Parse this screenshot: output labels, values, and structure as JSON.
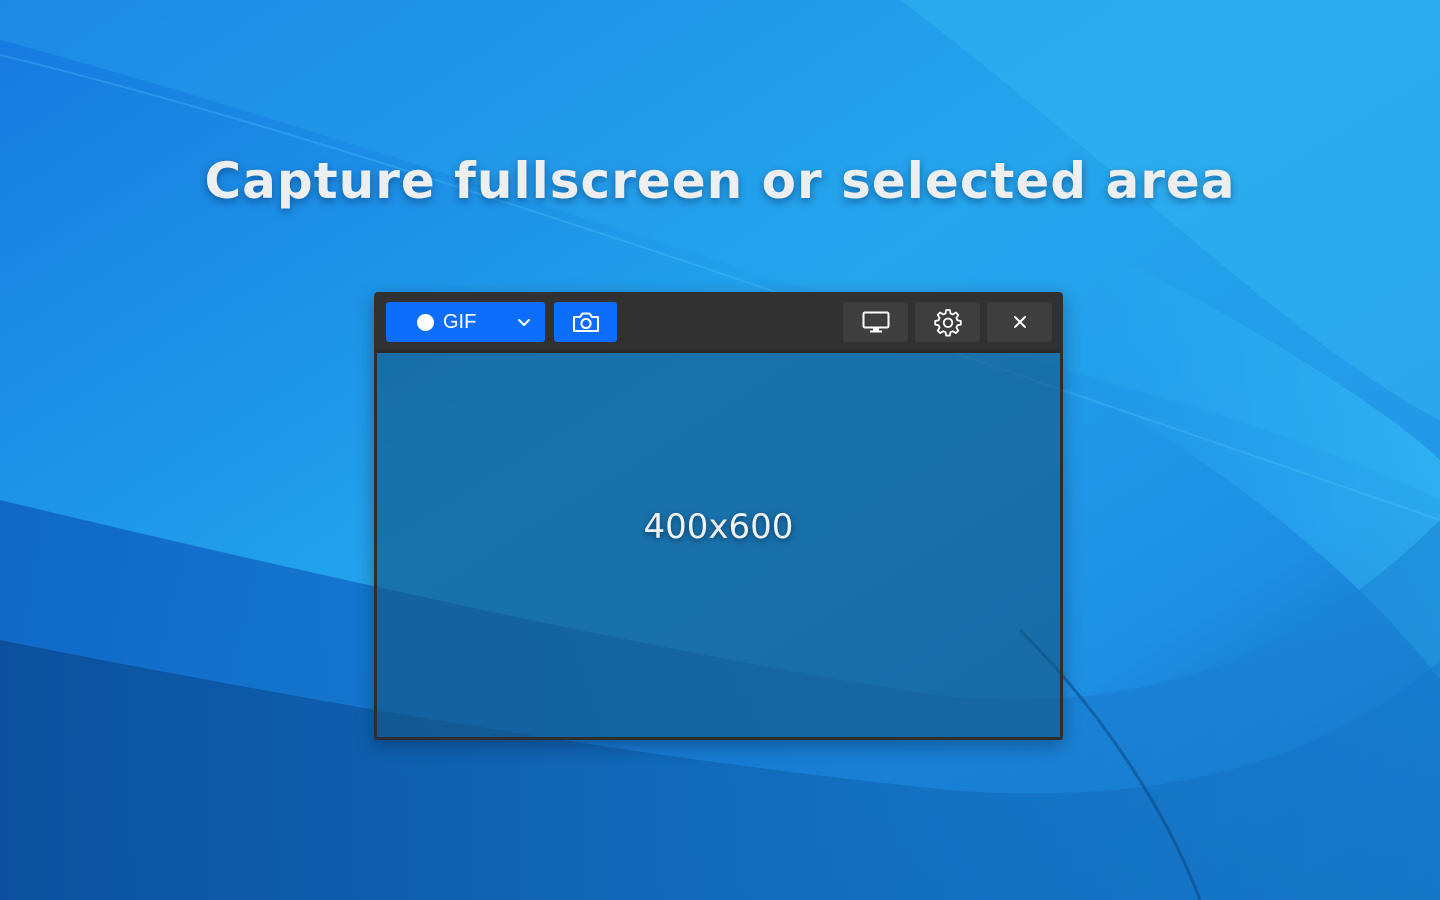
{
  "headline": "Capture fullscreen or selected area",
  "toolbar": {
    "record_format": "GIF",
    "record_dropdown_icon": "chevron-down-icon",
    "record_indicator_icon": "record-dot-icon",
    "screenshot_icon": "camera-icon",
    "fullscreen_icon": "monitor-icon",
    "settings_icon": "gear-icon",
    "close_icon": "close-icon"
  },
  "capture_area": {
    "size_label": "400x600"
  },
  "colors": {
    "accent": "#0d6efd",
    "toolbar_bg": "#313131",
    "toolbar_button_bg": "#3e3e3e"
  }
}
